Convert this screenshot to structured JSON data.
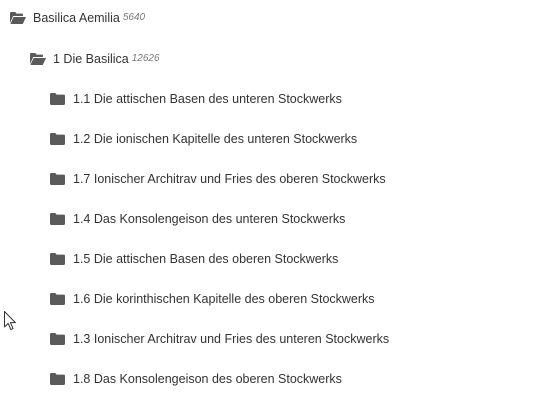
{
  "tree": {
    "root": {
      "label": "Basilica Aemilia",
      "count": "5640",
      "icon": "folder-open-icon"
    },
    "child": {
      "label": "1 Die Basilica",
      "count": "12626",
      "icon": "folder-open-icon"
    },
    "items": [
      {
        "label": "1.1 Die attischen Basen des unteren Stockwerks",
        "icon": "folder-icon"
      },
      {
        "label": "1.2 Die ionischen Kapitelle des unteren Stockwerks",
        "icon": "folder-icon"
      },
      {
        "label": "1.7 Ionischer Architrav und Fries des oberen Stockwerks",
        "icon": "folder-icon"
      },
      {
        "label": "1.4 Das Konsolengeison des unteren Stockwerks",
        "icon": "folder-icon"
      },
      {
        "label": "1.5 Die attischen Basen des oberen Stockwerks",
        "icon": "folder-icon"
      },
      {
        "label": "1.6 Die korinthischen Kapitelle des oberen Stockwerks",
        "icon": "folder-icon"
      },
      {
        "label": "1.3 Ionischer Architrav und Fries des unteren Stockwerks",
        "icon": "folder-icon"
      },
      {
        "label": "1.8 Das Konsolengeison des oberen Stockwerks",
        "icon": "folder-icon"
      }
    ]
  },
  "colors": {
    "icon": "#5a5a5a",
    "text": "#333333",
    "count": "#777777"
  }
}
